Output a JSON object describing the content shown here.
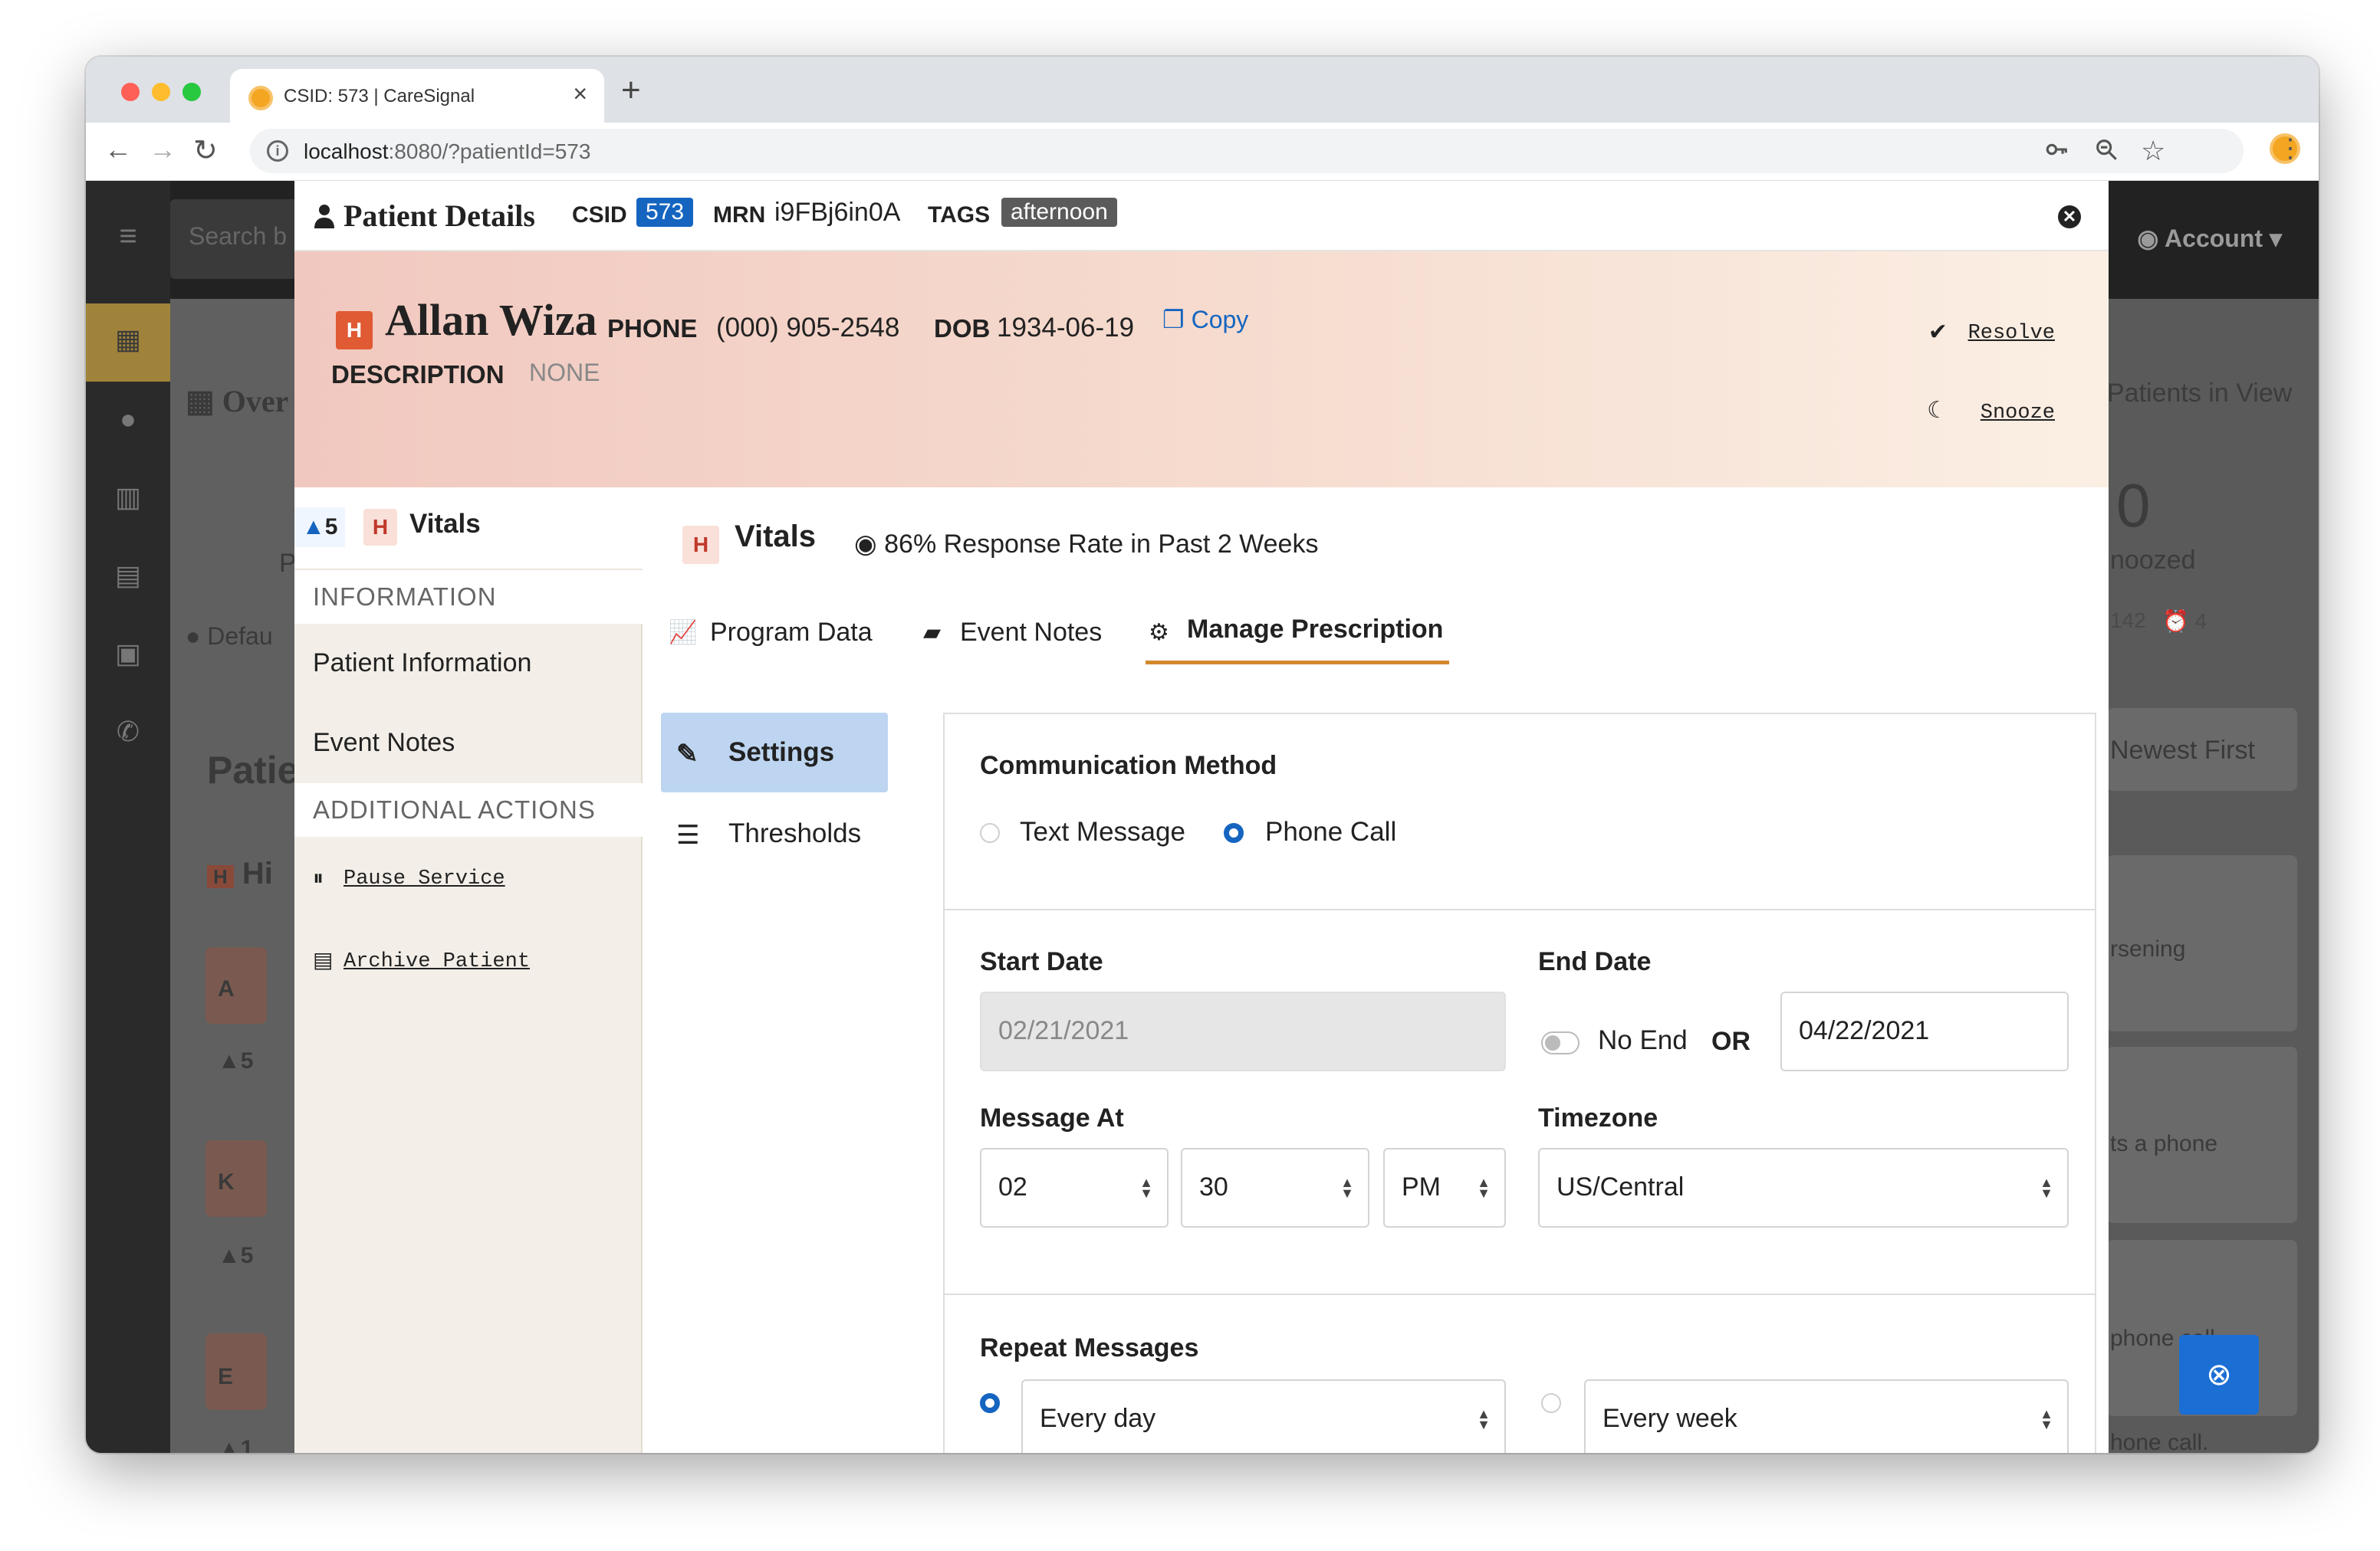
{
  "browser": {
    "tab_title": "CSID: 573 | CareSignal",
    "url_host": "localhost",
    "url_rest": ":8080/?patientId=573",
    "new_tab": "+",
    "tab_close": "×"
  },
  "background_app": {
    "search_placeholder": "Search b",
    "account_label": "Account",
    "overview_label": "Over",
    "patients_in_view": "Patients in View",
    "snoozed_count": "0",
    "snoozed_label": "noozed",
    "counts_a": "142",
    "counts_b": "4",
    "default_label": "Defau",
    "patients_heading": "Patie",
    "sort_label": "Newest First",
    "list_fragments": [
      "rsening",
      "ts a phone",
      "phone call.",
      "hone call."
    ],
    "left_cards": [
      {
        "letter": "A",
        "count": "5"
      },
      {
        "letter": "K",
        "count": "5"
      },
      {
        "letter": "E",
        "count": "1"
      }
    ],
    "row_heading": "Hi",
    "p_letter": "P"
  },
  "modal": {
    "title": "Patient Details",
    "csid_label": "CSID",
    "csid_value": "573",
    "mrn_label": "MRN",
    "mrn_value": "i9FBj6in0A",
    "tags_label": "TAGS",
    "tag_value": "afternoon",
    "patient": {
      "risk_letter": "H",
      "name": "Allan Wiza",
      "phone_label": "PHONE",
      "phone_value": "(000) 905-2548",
      "dob_label": "DOB",
      "dob_value": "1934-06-19",
      "copy_label": "Copy",
      "description_label": "DESCRIPTION",
      "description_value": "NONE"
    },
    "actions": {
      "resolve": "Resolve",
      "snooze": "Snooze"
    },
    "left_nav": {
      "alert_count": "5",
      "risk_letter": "H",
      "program": "Vitals",
      "information_header": "INFORMATION",
      "items": [
        "Patient Information",
        "Event Notes"
      ],
      "additional_header": "ADDITIONAL ACTIONS",
      "pause_service": "Pause Service",
      "archive_patient": "Archive Patient"
    },
    "program": {
      "risk_letter": "H",
      "name": "Vitals",
      "response_rate": "86% Response Rate in Past 2 Weeks"
    },
    "tabs": [
      "Program Data",
      "Event Notes",
      "Manage Prescription"
    ],
    "side_tabs": [
      "Settings",
      "Thresholds"
    ],
    "form": {
      "communication_method_label": "Communication Method",
      "text_message_label": "Text Message",
      "phone_call_label": "Phone Call",
      "start_date_label": "Start Date",
      "start_date_value": "02/21/2021",
      "end_date_label": "End Date",
      "no_end_label": "No End",
      "or_label": "OR",
      "end_date_value": "04/22/2021",
      "message_at_label": "Message At",
      "hour": "02",
      "minute": "30",
      "ampm": "PM",
      "timezone_label": "Timezone",
      "timezone": "US/Central",
      "repeat_label": "Repeat Messages",
      "repeat_daily": "Every day",
      "repeat_weekly": "Every week"
    }
  },
  "colors": {
    "accent_blue": "#1565c0",
    "risk_high": "#e05a33",
    "tab_underline": "#d3892f"
  }
}
